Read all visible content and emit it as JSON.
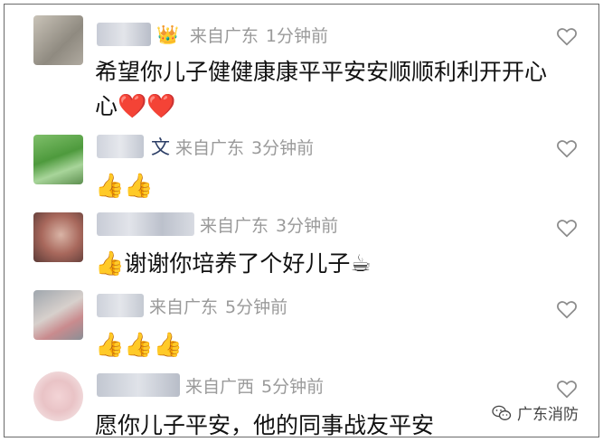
{
  "comments": [
    {
      "username_visible": "",
      "badge": "👑",
      "location": "来自广东",
      "time": "1分钟前",
      "text_line1": "希望你儿子健健康康平平安安顺顺利利开开心",
      "text_line2": "心",
      "text_emoji": "❤️❤️"
    },
    {
      "username_visible": "文",
      "location": "来自广东",
      "time": "3分钟前",
      "text_emoji": "👍👍"
    },
    {
      "username_visible": "",
      "location": "来自广东",
      "time": "3分钟前",
      "text_lead_emoji": "👍",
      "text": "谢谢你培养了个好儿子",
      "text_trail_emoji": "☕"
    },
    {
      "username_visible": "",
      "location": "来自广东",
      "time": "5分钟前",
      "text_emoji": "👍👍👍"
    },
    {
      "username_visible": "",
      "location": "来自广西",
      "time": "5分钟前",
      "text": "愿你儿子平安，他的同事战友平安"
    }
  ],
  "watermark": {
    "icon": "wechat-icon",
    "label": "广东消防"
  },
  "colors": {
    "meta": "#9a9a9a",
    "text": "#111111",
    "username": "#2c3e66"
  }
}
